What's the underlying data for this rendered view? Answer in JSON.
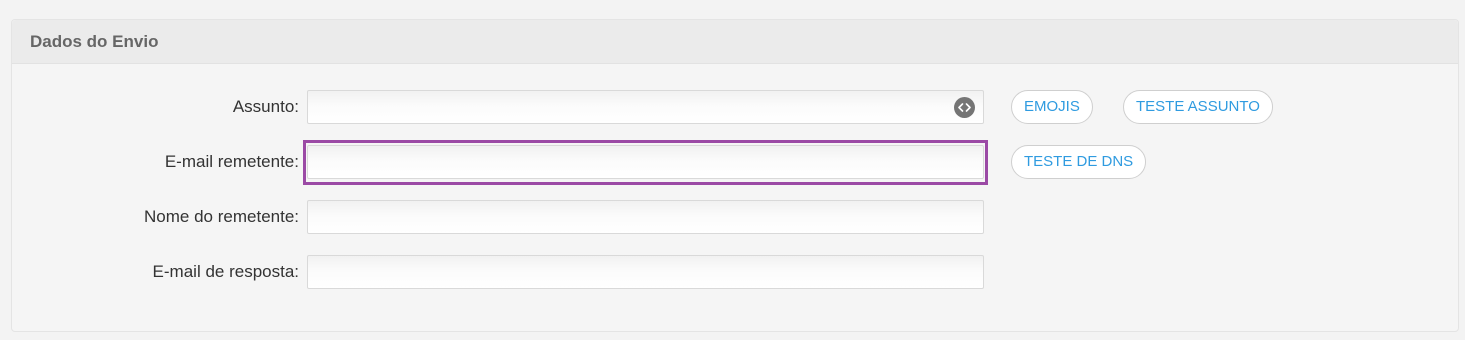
{
  "panel": {
    "title": "Dados do Envio"
  },
  "form": {
    "subject": {
      "label": "Assunto:",
      "value": "",
      "icon": "code-icon"
    },
    "sender_email": {
      "label": "E-mail remetente:",
      "value": ""
    },
    "sender_name": {
      "label": "Nome do remetente:",
      "value": ""
    },
    "reply_email": {
      "label": "E-mail de resposta:",
      "value": ""
    }
  },
  "buttons": {
    "emojis": "EMOJIS",
    "test_subject": "TESTE ASSUNTO",
    "test_dns": "TESTE DE DNS"
  },
  "colors": {
    "accent": "#2f9be0",
    "focus": "#9b4aa5",
    "header_bg": "#ebebeb",
    "panel_bg": "#f5f5f5"
  }
}
